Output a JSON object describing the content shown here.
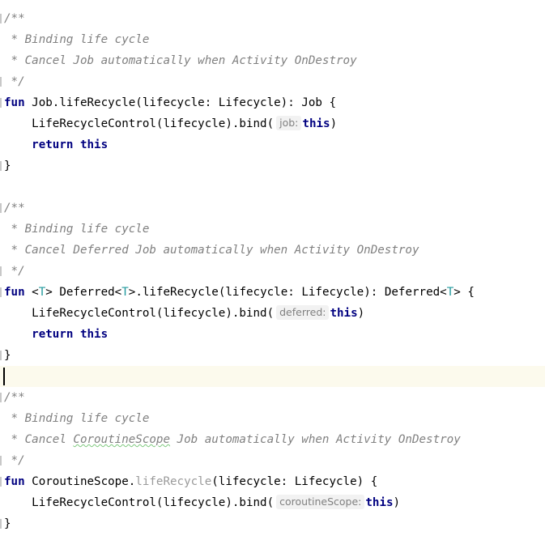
{
  "editor": {
    "blocks": [
      {
        "comment_open": "/**",
        "comment_line1": " * Binding life cycle",
        "comment_line2_prefix": " * Cancel ",
        "comment_line2_word": "",
        "comment_line2_suffix": "Job automatically when Activity OnDestroy",
        "comment_close": " */",
        "kw_fun": "fun",
        "signature_plain_before": " Job.lifeRecycle(lifecycle: Lifecycle): Job {",
        "call_text": "    LifeRecycleControl(lifecycle).bind(",
        "hint_label": "job:",
        "kw_this": "this",
        "call_close": ")",
        "kw_return": "return",
        "close_brace": "}"
      },
      {
        "comment_open": "/**",
        "comment_line1": " * Binding life cycle",
        "comment_line2_prefix": " * Cancel ",
        "comment_line2_word": "",
        "comment_line2_suffix": "Deferred Job automatically when Activity OnDestroy",
        "comment_close": " */",
        "kw_fun": "fun",
        "sig_lt": " <",
        "type_param": "T",
        "sig_mid1": "> Deferred<",
        "sig_mid2": ">.lifeRecycle(lifecycle: Lifecycle): Deferred<",
        "sig_end": "> {",
        "call_text": "    LifeRecycleControl(lifecycle).bind(",
        "hint_label": "deferred:",
        "kw_this": "this",
        "call_close": ")",
        "kw_return": "return",
        "close_brace": "}"
      },
      {
        "comment_open": "/**",
        "comment_line1": " * Binding life cycle",
        "comment_line2_prefix": " * Cancel ",
        "comment_line2_word": "CoroutineScope",
        "comment_line2_suffix": " Job automatically when Activity OnDestroy",
        "comment_close": " */",
        "kw_fun": "fun",
        "sig_receiver": " CoroutineScope.",
        "sig_ext_name": "lifeRecycle",
        "sig_rest": "(lifecycle: Lifecycle) {",
        "call_text": "    LifeRecycleControl(lifecycle).bind(",
        "hint_label": "coroutineScope:",
        "kw_this": "this",
        "call_close": ")",
        "close_brace": "}"
      }
    ],
    "colors": {
      "keyword": "#000080",
      "comment": "#808080",
      "type_param": "#20999d",
      "extension_fn": "#9a9a9a",
      "current_line": "#fcfaed"
    }
  }
}
